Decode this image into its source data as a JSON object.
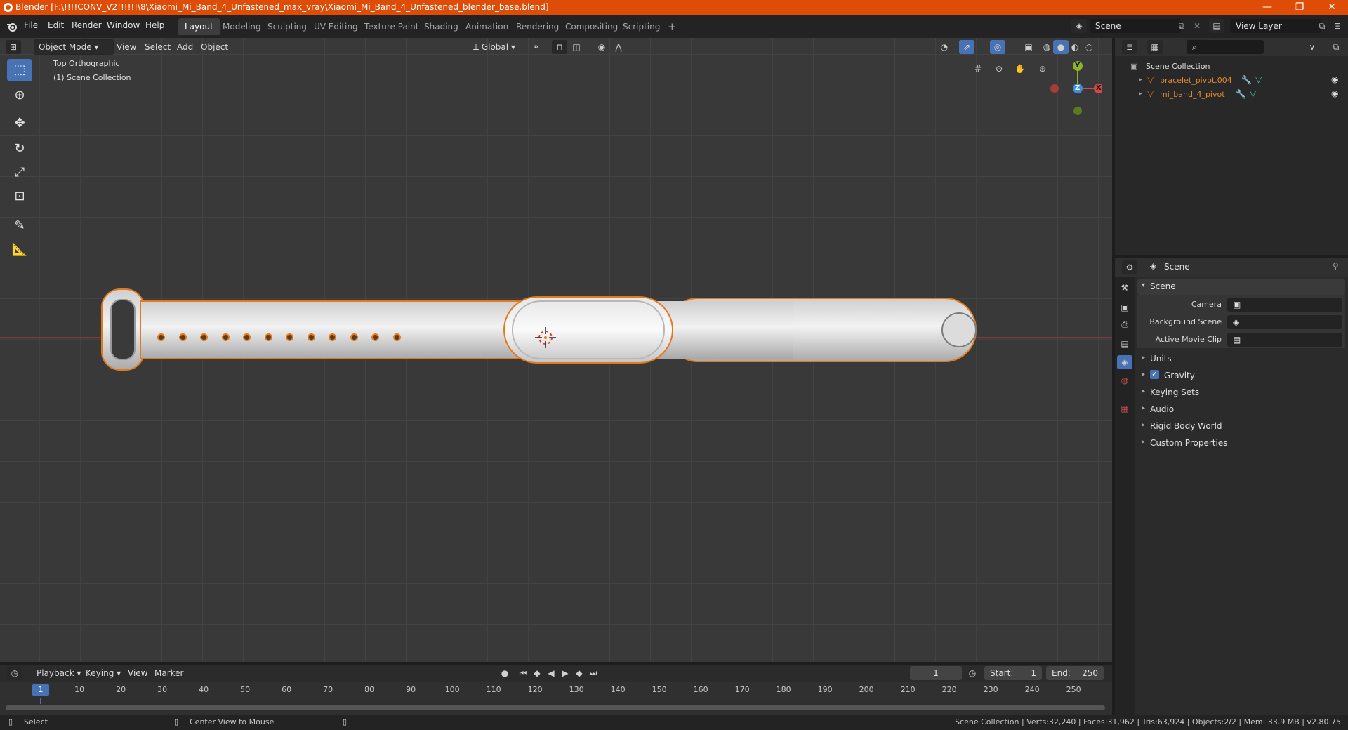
{
  "window": {
    "title": "Blender [F:\\!!!!CONV_V2!!!!!!\\8\\Xiaomi_Mi_Band_4_Unfastened_max_vray\\Xiaomi_Mi_Band_4_Unfastened_blender_base.blend]",
    "minimize": "—",
    "maximize": "❐",
    "close": "✕"
  },
  "menubar": {
    "menus": [
      "File",
      "Edit",
      "Render",
      "Window",
      "Help"
    ],
    "workspaces": [
      "Layout",
      "Modeling",
      "Sculpting",
      "UV Editing",
      "Texture Paint",
      "Shading",
      "Animation",
      "Rendering",
      "Compositing",
      "Scripting"
    ],
    "active_workspace": "Layout",
    "add_tab": "+",
    "scene_name": "Scene",
    "view_layer": "View Layer"
  },
  "viewport": {
    "mode": "Object Mode",
    "menus": [
      "View",
      "Select",
      "Add",
      "Object"
    ],
    "transform_orientation": "Global",
    "view_name": "Top Orthographic",
    "collection_label": "(1) Scene Collection",
    "gizmo": {
      "y": "Y",
      "z": "Z",
      "x": "X"
    },
    "strap_hole_count": 12
  },
  "outliner": {
    "root": "Scene Collection",
    "items": [
      {
        "name": "bracelet_pivot.004"
      },
      {
        "name": "mi_band_4_pivot"
      }
    ]
  },
  "properties": {
    "header_title": "Scene",
    "panel_title": "Scene",
    "fields": [
      {
        "label": "Camera",
        "value": ""
      },
      {
        "label": "Background Scene",
        "value": ""
      },
      {
        "label": "Active Movie Clip",
        "value": ""
      }
    ],
    "sections": [
      "Units",
      "Gravity",
      "Keying Sets",
      "Audio",
      "Rigid Body World",
      "Custom Properties"
    ],
    "gravity_checked": true
  },
  "timeline": {
    "menus": [
      "Playback",
      "Keying",
      "View",
      "Marker"
    ],
    "current_frame": "1",
    "start_label": "Start:",
    "start_value": "1",
    "end_label": "End:",
    "end_value": "250",
    "ticks": [
      "1",
      "10",
      "20",
      "30",
      "40",
      "50",
      "60",
      "70",
      "80",
      "90",
      "100",
      "110",
      "120",
      "130",
      "140",
      "150",
      "160",
      "170",
      "180",
      "190",
      "200",
      "210",
      "220",
      "230",
      "240",
      "250"
    ]
  },
  "statusbar": {
    "left_action": "Select",
    "middle_action": "Center View to Mouse",
    "info": "Scene Collection | Verts:32,240 | Faces:31,962 | Tris:63,924 | Objects:2/2 | Mem: 33.9 MB | v2.80.75"
  },
  "colors": {
    "accent": "#4772b3",
    "title_bar": "#de4d07",
    "selection_outline": "#e07a1f",
    "axis_x": "#d04a4a",
    "axis_y": "#8bb32a",
    "axis_z": "#3c8fd8"
  }
}
